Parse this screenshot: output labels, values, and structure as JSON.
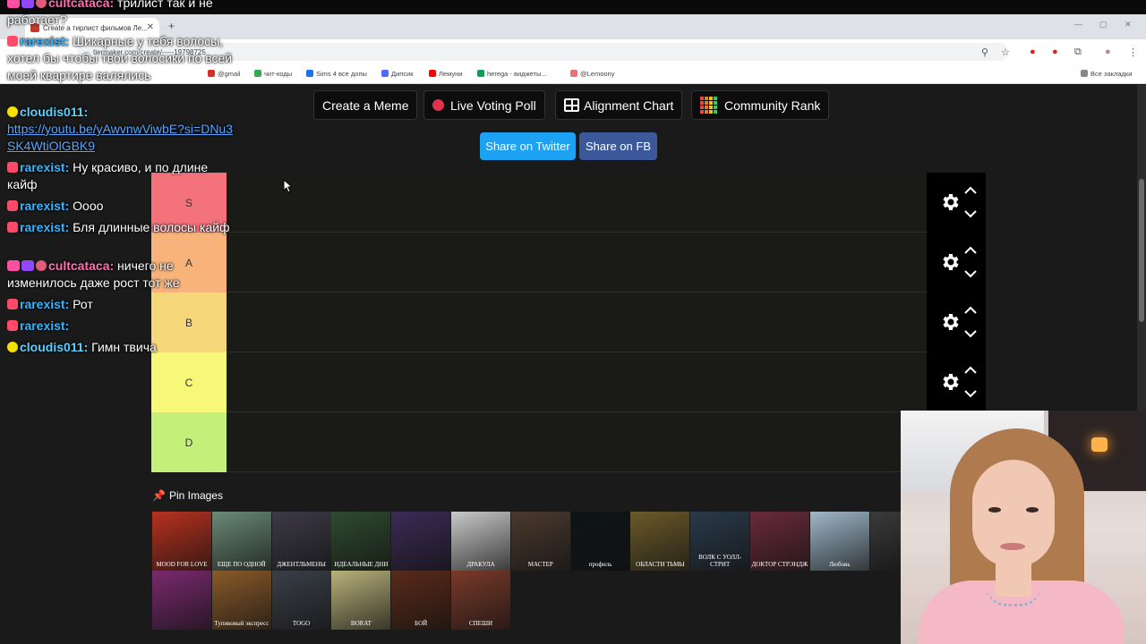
{
  "browser": {
    "tab_title": "Create a тирлист фильмов Ле...",
    "url": "tiermaker.com/create/-----19798725",
    "bookmarks": [
      {
        "label": "@gmail",
        "color": "#d93025"
      },
      {
        "label": "чит-коды",
        "color": "#34a853"
      },
      {
        "label": "Sims 4 все допы",
        "color": "#1a73e8"
      },
      {
        "label": "Дипсик",
        "color": "#4d6bfe"
      },
      {
        "label": "Лемуни",
        "color": "#ff0000"
      },
      {
        "label": "herega - виджеты...",
        "color": "#0f9d58"
      },
      {
        "label": "@Lemoony",
        "color": "#e57373"
      }
    ],
    "all_bookmarks": "Все закладки"
  },
  "toolbar": {
    "create_meme": "Create a Meme",
    "live_poll": "Live Voting Poll",
    "alignment": "Alignment Chart",
    "community": "Community Rank",
    "share_twitter": "Share on Twitter",
    "share_fb": "Share on FB"
  },
  "tiers": [
    {
      "label": "S",
      "color": "#f4727a"
    },
    {
      "label": "A",
      "color": "#f7b37a"
    },
    {
      "label": "B",
      "color": "#f6d77a"
    },
    {
      "label": "C",
      "color": "#f7f77a"
    },
    {
      "label": "D",
      "color": "#c4f07a"
    }
  ],
  "pin_images": "Pin Images",
  "posters": [
    {
      "title": "MOOD FOR LOVE",
      "bg": "#b8321f"
    },
    {
      "title": "ЕЩЕ ПО ОДНОЙ",
      "bg": "#6a8a74"
    },
    {
      "title": "ДЖЕНТЛЬМЕНЫ",
      "bg": "#3d3a46"
    },
    {
      "title": "ИДЕАЛЬНЫЕ ДНИ",
      "bg": "#2f4a2f"
    },
    {
      "title": "",
      "bg": "#3b2b56"
    },
    {
      "title": "ДРАКУЛА",
      "bg": "#c9c9c9"
    },
    {
      "title": "МАСТЕР",
      "bg": "#4a3a2e"
    },
    {
      "title": "профиль",
      "bg": "#0e1416"
    },
    {
      "title": "ОБЛАСТИ ТЬМЫ",
      "bg": "#6b5a2a"
    },
    {
      "title": "ВОЛК С УОЛЛ-СТРИТ",
      "bg": "#2a3a4a"
    },
    {
      "title": "ДОКТОР СТРЭНДЖ",
      "bg": "#6a2a3a"
    },
    {
      "title": "Любовь",
      "bg": "#9fb7c9"
    },
    {
      "title": "",
      "bg": "#3a3a3a"
    },
    {
      "title": "",
      "bg": "#7a2a6e"
    },
    {
      "title": "Тупиковый экспресс",
      "bg": "#8a5a2a"
    },
    {
      "title": "TOGO",
      "bg": "#3a4048"
    },
    {
      "title": "BORAT",
      "bg": "#b9b27a"
    },
    {
      "title": "БОЙ",
      "bg": "#5a2a1a"
    },
    {
      "title": "СПЕШИ",
      "bg": "#7a3a2a"
    }
  ],
  "chat": [
    {
      "name": "cultcataca:",
      "text": "трилист так и не работает?",
      "color": "pink"
    },
    {
      "name": "rarexist:",
      "text": "Шикарные у тебя волосы, хотел бы чтобы твои волосики по всей моей квартире валялись",
      "color": "blue"
    },
    {
      "name": "cloudis011:",
      "text": "",
      "color": "cyan"
    },
    {
      "link": "https://youtu.be/yAwvnwViwbE?si=DNu3SK4WtiOlGBK9"
    },
    {
      "name": "rarexist:",
      "text": "Ну красиво, и по длине кайф",
      "color": "blue"
    },
    {
      "name": "rarexist:",
      "text": "Оооо",
      "color": "blue"
    },
    {
      "name": "rarexist:",
      "text": "Бля длинные волосы кайф",
      "color": "blue"
    },
    {
      "name": "cultcataca:",
      "text": "ничего не изменилось даже рост тот же",
      "color": "pink"
    },
    {
      "name": "rarexist:",
      "text": "Рот",
      "color": "blue"
    },
    {
      "name": "rarexist:",
      "text": "",
      "color": "blue"
    },
    {
      "name": "cloudis011:",
      "text": "Гимн твича",
      "color": "cyan"
    }
  ]
}
